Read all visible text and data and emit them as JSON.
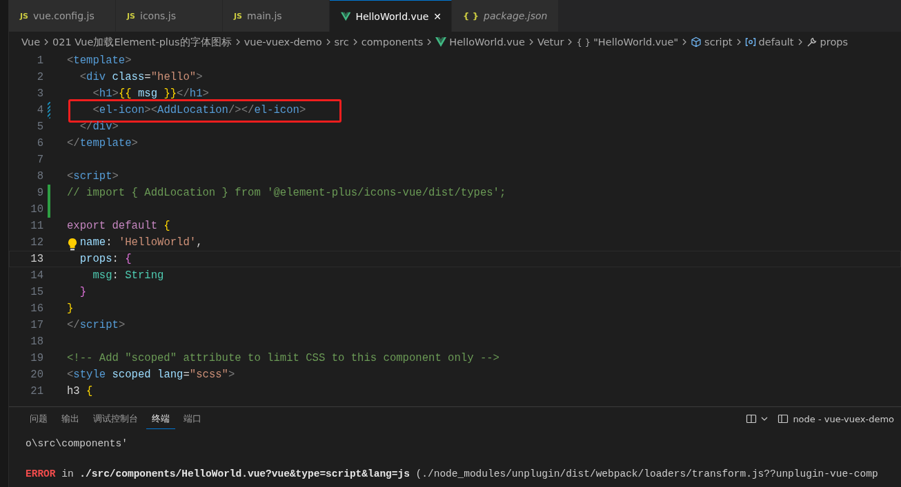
{
  "tabs": [
    {
      "kind": "js",
      "badge": "JS",
      "label": "vue.config.js",
      "selected": false,
      "preview": false
    },
    {
      "kind": "js",
      "badge": "JS",
      "label": "icons.js",
      "selected": false,
      "preview": false
    },
    {
      "kind": "js",
      "badge": "JS",
      "label": "main.js",
      "selected": false,
      "preview": false
    },
    {
      "kind": "vue",
      "label": "HelloWorld.vue",
      "selected": true,
      "preview": false,
      "close": "✕"
    },
    {
      "kind": "json",
      "badge": "{ }",
      "label": "package.json",
      "selected": false,
      "preview": true
    }
  ],
  "breadcrumbs": [
    {
      "kind": "text",
      "label": "Vue"
    },
    {
      "kind": "text",
      "label": "021 Vue加载Element-plus的字体图标"
    },
    {
      "kind": "text",
      "label": "vue-vuex-demo"
    },
    {
      "kind": "text",
      "label": "src"
    },
    {
      "kind": "text",
      "label": "components"
    },
    {
      "kind": "vue",
      "label": "HelloWorld.vue"
    },
    {
      "kind": "text",
      "label": "Vetur"
    },
    {
      "kind": "braces",
      "badge": "{ }",
      "label": "\"HelloWorld.vue\""
    },
    {
      "kind": "cube",
      "label": "script"
    },
    {
      "kind": "symbol",
      "label": "default"
    },
    {
      "kind": "wrench",
      "label": "props"
    }
  ],
  "editor": {
    "lines": [
      {
        "number": "1",
        "current": false,
        "modified": false,
        "added": false,
        "lightbulb": false,
        "highlight": false,
        "tokens": [
          {
            "kind": "punc",
            "text": "<"
          },
          {
            "kind": "tag",
            "text": "template"
          },
          {
            "kind": "punc",
            "text": ">"
          }
        ]
      },
      {
        "number": "2",
        "current": false,
        "modified": false,
        "added": false,
        "lightbulb": false,
        "highlight": false,
        "tokens": [
          {
            "kind": "punc",
            "text": "  <"
          },
          {
            "kind": "tag",
            "text": "div"
          },
          {
            "kind": "attr",
            "text": " class"
          },
          {
            "kind": "plain",
            "text": "="
          },
          {
            "kind": "string",
            "text": "\"hello\""
          },
          {
            "kind": "punc",
            "text": ">"
          }
        ]
      },
      {
        "number": "3",
        "current": false,
        "modified": false,
        "added": false,
        "lightbulb": false,
        "highlight": false,
        "tokens": [
          {
            "kind": "punc",
            "text": "    <"
          },
          {
            "kind": "tag",
            "text": "h1"
          },
          {
            "kind": "punc",
            "text": ">"
          },
          {
            "kind": "brace",
            "text": "{{"
          },
          {
            "kind": "attr",
            "text": " msg "
          },
          {
            "kind": "brace",
            "text": "}}"
          },
          {
            "kind": "punc",
            "text": "</"
          },
          {
            "kind": "tag",
            "text": "h1"
          },
          {
            "kind": "punc",
            "text": ">"
          }
        ]
      },
      {
        "number": "4",
        "current": false,
        "modified": true,
        "added": false,
        "lightbulb": false,
        "highlight": true,
        "tokens": [
          {
            "kind": "punc",
            "text": "    <"
          },
          {
            "kind": "tag",
            "text": "el-icon"
          },
          {
            "kind": "punc",
            "text": "><"
          },
          {
            "kind": "tag",
            "text": "AddLocation"
          },
          {
            "kind": "punc",
            "text": "/></"
          },
          {
            "kind": "tag",
            "text": "el-icon"
          },
          {
            "kind": "punc",
            "text": ">"
          }
        ]
      },
      {
        "number": "5",
        "current": false,
        "modified": false,
        "added": false,
        "lightbulb": false,
        "highlight": false,
        "tokens": [
          {
            "kind": "punc",
            "text": "  </"
          },
          {
            "kind": "tag",
            "text": "div"
          },
          {
            "kind": "punc",
            "text": ">"
          }
        ]
      },
      {
        "number": "6",
        "current": false,
        "modified": false,
        "added": false,
        "lightbulb": false,
        "highlight": false,
        "tokens": [
          {
            "kind": "punc",
            "text": "</"
          },
          {
            "kind": "tag",
            "text": "template"
          },
          {
            "kind": "punc",
            "text": ">"
          }
        ]
      },
      {
        "number": "7",
        "current": false,
        "modified": false,
        "added": false,
        "lightbulb": false,
        "highlight": false
      },
      {
        "number": "8",
        "current": false,
        "modified": false,
        "added": false,
        "lightbulb": false,
        "highlight": false,
        "tokens": [
          {
            "kind": "punc",
            "text": "<"
          },
          {
            "kind": "tag",
            "text": "script"
          },
          {
            "kind": "punc",
            "text": ">"
          }
        ]
      },
      {
        "number": "9",
        "current": false,
        "modified": false,
        "added": true,
        "lightbulb": false,
        "highlight": false,
        "tokens": [
          {
            "kind": "comment",
            "text": "// import { AddLocation } from '@element-plus/icons-vue/dist/types';"
          }
        ]
      },
      {
        "number": "10",
        "current": false,
        "modified": false,
        "added": true,
        "lightbulb": false,
        "highlight": false
      },
      {
        "number": "11",
        "current": false,
        "modified": false,
        "added": false,
        "lightbulb": false,
        "highlight": false,
        "tokens": [
          {
            "kind": "keyword",
            "text": "export default"
          },
          {
            "kind": "brace",
            "text": " {"
          }
        ]
      },
      {
        "number": "12",
        "current": false,
        "modified": false,
        "added": false,
        "lightbulb": true,
        "highlight": false,
        "tokens": [
          {
            "kind": "attr",
            "text": "  name"
          },
          {
            "kind": "plain",
            "text": ": "
          },
          {
            "kind": "string",
            "text": "'HelloWorld'"
          },
          {
            "kind": "plain",
            "text": ","
          }
        ]
      },
      {
        "number": "13",
        "current": true,
        "modified": false,
        "added": false,
        "lightbulb": false,
        "highlight": false,
        "tokens": [
          {
            "kind": "attr",
            "text": "  props"
          },
          {
            "kind": "plain",
            "text": ": "
          },
          {
            "kind": "brace2",
            "text": "{"
          }
        ]
      },
      {
        "number": "14",
        "current": false,
        "modified": false,
        "added": false,
        "lightbulb": false,
        "highlight": false,
        "tokens": [
          {
            "kind": "type",
            "text": "    msg"
          },
          {
            "kind": "plain",
            "text": ": "
          },
          {
            "kind": "type",
            "text": "String"
          }
        ]
      },
      {
        "number": "15",
        "current": false,
        "modified": false,
        "added": false,
        "lightbulb": false,
        "highlight": false,
        "tokens": [
          {
            "kind": "brace2",
            "text": "  }"
          }
        ]
      },
      {
        "number": "16",
        "current": false,
        "modified": false,
        "added": false,
        "lightbulb": false,
        "highlight": false,
        "tokens": [
          {
            "kind": "brace",
            "text": "}"
          }
        ]
      },
      {
        "number": "17",
        "current": false,
        "modified": false,
        "added": false,
        "lightbulb": false,
        "highlight": false,
        "tokens": [
          {
            "kind": "punc",
            "text": "</"
          },
          {
            "kind": "tag",
            "text": "script"
          },
          {
            "kind": "punc",
            "text": ">"
          }
        ]
      },
      {
        "number": "18",
        "current": false,
        "modified": false,
        "added": false,
        "lightbulb": false,
        "highlight": false
      },
      {
        "number": "19",
        "current": false,
        "modified": false,
        "added": false,
        "lightbulb": false,
        "highlight": false,
        "tokens": [
          {
            "kind": "comment",
            "text": "<!-- Add \"scoped\" attribute to limit CSS to this component only -->"
          }
        ]
      },
      {
        "number": "20",
        "current": false,
        "modified": false,
        "added": false,
        "lightbulb": false,
        "highlight": false,
        "tokens": [
          {
            "kind": "punc",
            "text": "<"
          },
          {
            "kind": "tag",
            "text": "style"
          },
          {
            "kind": "attr",
            "text": " scoped lang"
          },
          {
            "kind": "plain",
            "text": "="
          },
          {
            "kind": "string",
            "text": "\"scss\""
          },
          {
            "kind": "punc",
            "text": ">"
          }
        ]
      },
      {
        "number": "21",
        "current": false,
        "modified": false,
        "added": false,
        "lightbulb": false,
        "highlight": false,
        "tokens": [
          {
            "kind": "plain",
            "text": "h3"
          },
          {
            "kind": "brace",
            "text": " {"
          }
        ]
      }
    ]
  },
  "panel": {
    "tabs": [
      {
        "label": "问题",
        "selected": false
      },
      {
        "label": "输出",
        "selected": false
      },
      {
        "label": "调试控制台",
        "selected": false
      },
      {
        "label": "终端",
        "selected": true
      },
      {
        "label": "端口",
        "selected": false
      }
    ],
    "terminal_name": "node - vue-vuex-demo",
    "output": [
      {
        "kind": "plain",
        "text": "o\\src\\components'"
      },
      {
        "kind": "error",
        "label": "ERROR",
        "text": " in",
        "path": " ./src/components/HelloWorld.vue?vue&type=script&lang=js",
        "rest": " (./node_modules/unplugin/dist/webpack/loaders/transform.js??unplugin-vue-comp"
      }
    ]
  }
}
